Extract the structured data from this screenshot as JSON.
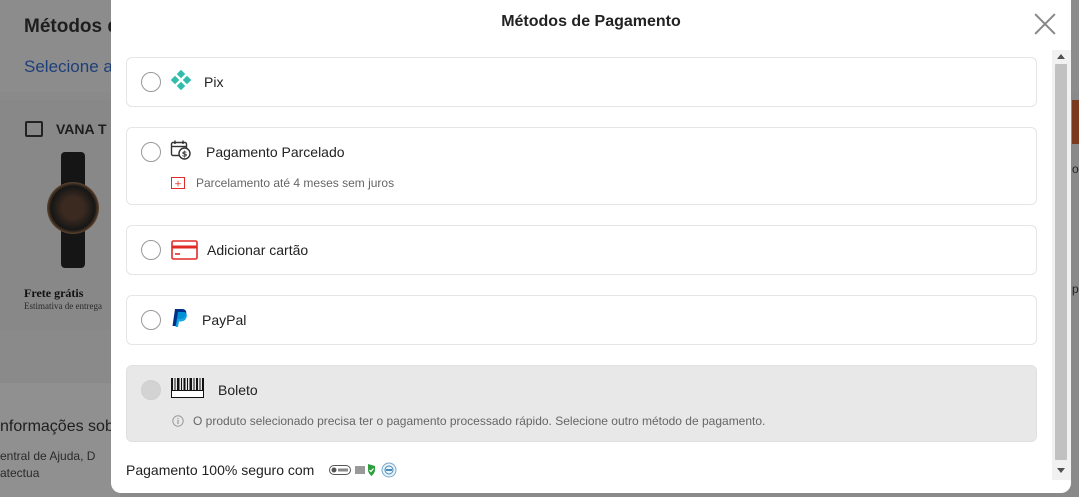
{
  "background": {
    "title": "Métodos d",
    "link": "Selecione a",
    "store_name": "VANA T",
    "shipping": "Frete grátis",
    "shipping_sub": "Estimativa de entrega",
    "info_title": "nformações sob",
    "info_line1": "entral de Ajuda, D",
    "info_line2": "atectua",
    "right_text1": "o",
    "right_text2": "p"
  },
  "modal": {
    "title": "Métodos de Pagamento",
    "options": [
      {
        "label": "Pix",
        "icon": "pix-icon"
      },
      {
        "label": "Pagamento Parcelado",
        "icon": "installment-calendar-icon",
        "sub": "Parcelamento até 4 meses sem juros"
      },
      {
        "label": "Adicionar cartão",
        "icon": "credit-card-icon"
      },
      {
        "label": "PayPal",
        "icon": "paypal-icon"
      },
      {
        "label": "Boleto",
        "icon": "boleto-barcode-icon",
        "sub": "O produto selecionado precisa ter o pagamento processado rápido. Selecione outro método de pagamento.",
        "disabled": true
      }
    ],
    "secure_text": "Pagamento 100% seguro com",
    "secure_badges": [
      "security-badge-icon",
      "shield-badge-icon",
      "seal-badge-icon"
    ]
  },
  "colors": {
    "pix": "#32bcad",
    "card_red": "#e02b27",
    "paypal_dark": "#003087",
    "paypal_light": "#009cde"
  }
}
